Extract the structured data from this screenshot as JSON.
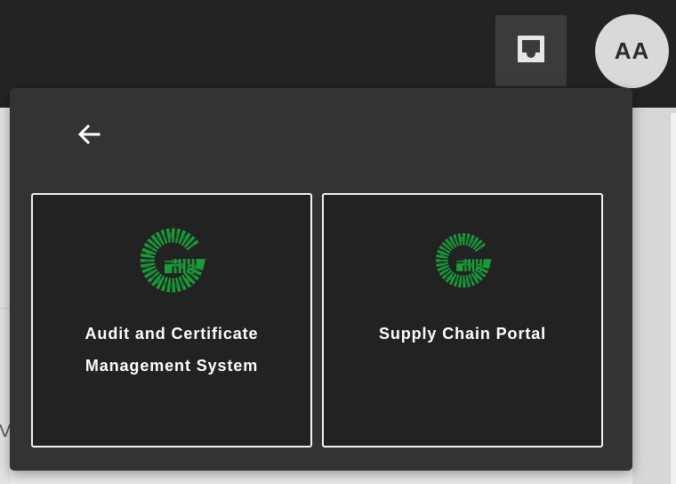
{
  "header": {
    "avatar_initials": "AA",
    "inbox_icon": "inbox-icon"
  },
  "background": {
    "left_glyph": "V"
  },
  "app_switcher": {
    "back_icon": "arrow-left-icon",
    "apps": [
      {
        "label": "Audit and Certificate Management System",
        "logo_icon": "g-logo-icon"
      },
      {
        "label": "Supply Chain Portal",
        "logo_icon": "g-logo-icon"
      }
    ]
  },
  "colors": {
    "topbar": "#232323",
    "menu_background": "#333333",
    "card_background": "#222222",
    "card_border": "#f2f2f2",
    "logo_green": "#1a9a3a",
    "avatar_background": "#d9d9d9"
  }
}
